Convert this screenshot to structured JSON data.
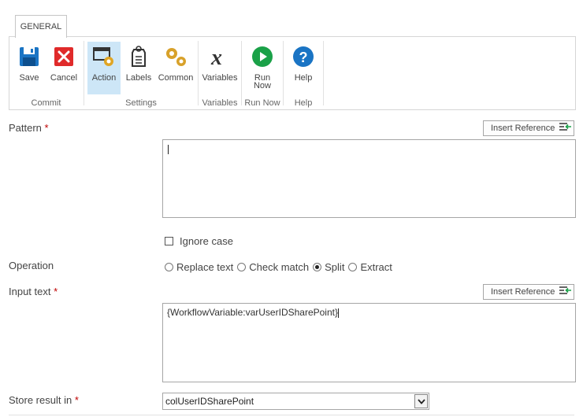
{
  "tab": {
    "label": "GENERAL"
  },
  "ribbon": {
    "buttons": {
      "save": "Save",
      "cancel": "Cancel",
      "action": "Action",
      "labels": "Labels",
      "common": "Common",
      "variables": "Variables",
      "run_now_line1": "Run",
      "run_now_line2": "Now",
      "help": "Help"
    },
    "groups": {
      "commit": "Commit",
      "settings": "Settings",
      "variables": "Variables",
      "run_now": "Run Now",
      "help": "Help"
    }
  },
  "form": {
    "pattern": {
      "label": "Pattern",
      "required": "*",
      "value": ""
    },
    "insert_reference": "Insert Reference",
    "ignore_case": {
      "label": "Ignore case",
      "checked": false
    },
    "operation": {
      "label": "Operation",
      "options": [
        "Replace text",
        "Check match",
        "Split",
        "Extract"
      ],
      "selected": "Split"
    },
    "input_text": {
      "label": "Input text",
      "required": "*",
      "value": "{WorkflowVariable:varUserIDSharePoint}"
    },
    "store_result": {
      "label": "Store result in",
      "required": "*",
      "value": "colUserIDSharePoint"
    }
  },
  "colors": {
    "accent_blue": "#1a74c4",
    "cancel_red": "#e02a2a",
    "run_green": "#1aa148",
    "selected_bg": "#cde6f7"
  }
}
